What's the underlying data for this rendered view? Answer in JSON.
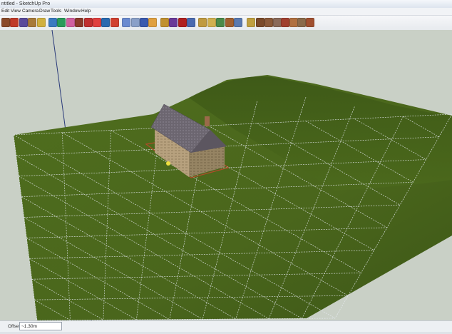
{
  "window": {
    "title": "ntitled - SketchUp Pro"
  },
  "menu": {
    "items": [
      "Edit",
      "View",
      "Camera",
      "Draw",
      "Tools",
      "Window",
      "Help"
    ]
  },
  "toolbar": {
    "tools": [
      {
        "name": "select-tool-icon",
        "color": "#8a4a2a"
      },
      {
        "name": "pencil-line-icon",
        "color": "#c03a2a"
      },
      {
        "name": "rectangle-icon",
        "color": "#5a4a9a"
      },
      {
        "name": "circle-icon",
        "color": "#a87a3a"
      },
      {
        "name": "arc-icon",
        "color": "#d0b040"
      },
      {
        "name": "polygon-icon",
        "color": "#3a7ac0"
      },
      {
        "name": "freehand-icon",
        "color": "#2a9a5a"
      },
      {
        "name": "eraser-icon",
        "color": "#d060a0"
      },
      {
        "name": "push-pull-icon",
        "color": "#8a3a2a"
      },
      {
        "name": "move-icon",
        "color": "#c03030"
      },
      {
        "name": "rotate-icon",
        "color": "#e04040"
      },
      {
        "name": "scale-icon",
        "color": "#2a6ab0"
      },
      {
        "name": "offset-icon",
        "color": "#d04030"
      },
      {
        "name": "tape-measure-icon",
        "color": "#6a8ad0"
      },
      {
        "name": "protractor-icon",
        "color": "#8aa0c8"
      },
      {
        "name": "axes-icon",
        "color": "#3a5ab0"
      },
      {
        "name": "text-icon",
        "color": "#e0a040"
      },
      {
        "name": "paint-bucket-icon",
        "color": "#c09030"
      },
      {
        "name": "orbit-icon",
        "color": "#6a3a9a"
      },
      {
        "name": "pan-icon",
        "color": "#b02020"
      },
      {
        "name": "zoom-icon",
        "color": "#4a6ab0"
      },
      {
        "name": "zoom-window-icon",
        "color": "#c09a40"
      },
      {
        "name": "zoom-extents-icon",
        "color": "#d0b050"
      },
      {
        "name": "walk-icon",
        "color": "#4a8a4a"
      },
      {
        "name": "look-around-icon",
        "color": "#a06030"
      },
      {
        "name": "position-camera-icon",
        "color": "#5a7ab0"
      },
      {
        "name": "section-plane-icon",
        "color": "#c0a040"
      },
      {
        "name": "dimensions-icon",
        "color": "#7a4a2a"
      },
      {
        "name": "component-icon",
        "color": "#8a5a3a"
      },
      {
        "name": "iso-view-icon",
        "color": "#8a6a5a"
      },
      {
        "name": "top-view-icon",
        "color": "#a04030"
      },
      {
        "name": "front-view-icon",
        "color": "#b07040"
      },
      {
        "name": "right-view-icon",
        "color": "#8a6a4a"
      },
      {
        "name": "back-view-icon",
        "color": "#a05030"
      }
    ]
  },
  "status": {
    "offset_label": "Offset",
    "offset_value": "~1.30m"
  },
  "colors": {
    "terrain": "#4d6a1d",
    "terrain_dark": "#3e5818",
    "mesh_line": "#e8ecf4",
    "sky": "#c9d0c6",
    "roof": "#6f6873",
    "wall": "#b39e7c",
    "wall_shadow": "#8d7c5f"
  }
}
